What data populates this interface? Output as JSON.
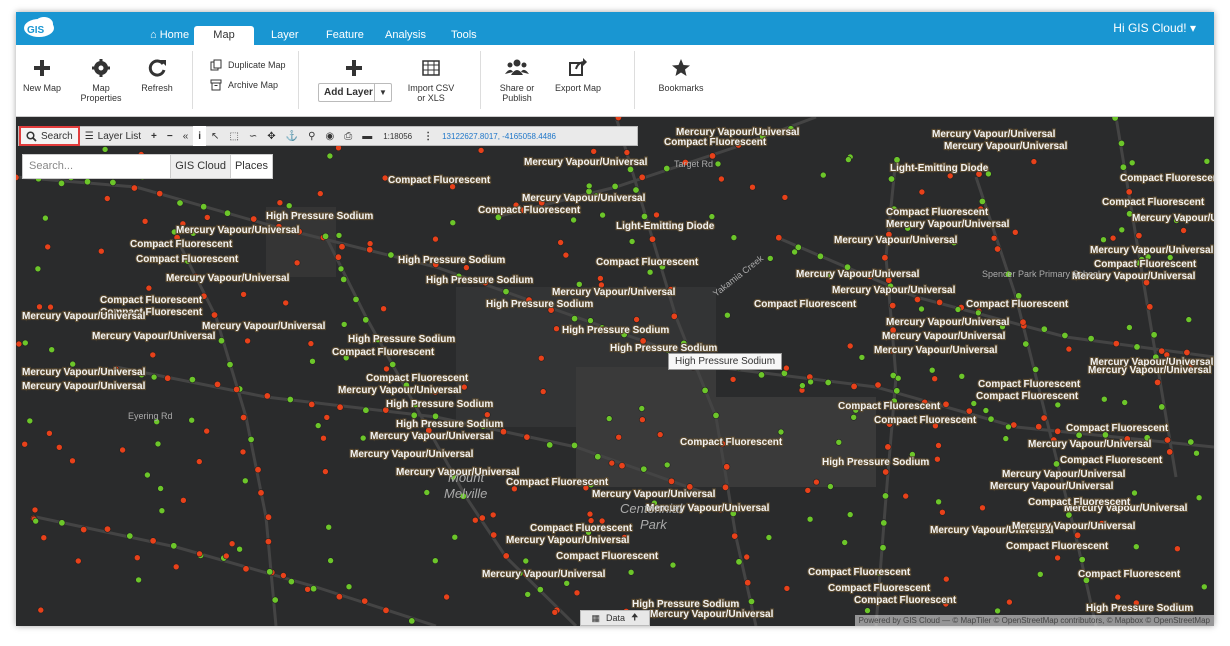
{
  "nav": {
    "logo": "GIS",
    "tabs": [
      {
        "label": "Home"
      },
      {
        "label": "Map"
      },
      {
        "label": "Layer"
      },
      {
        "label": "Feature"
      },
      {
        "label": "Analysis"
      },
      {
        "label": "Tools"
      }
    ],
    "user": "Hi GIS Cloud! ▾"
  },
  "ribbon": {
    "new_map": "New Map",
    "map_properties_1": "Map",
    "map_properties_2": "Properties",
    "refresh": "Refresh",
    "duplicate_map": "Duplicate Map",
    "archive_map": "Archive Map",
    "add_layer": "Add Layer",
    "import_1": "Import CSV",
    "import_2": "or XLS",
    "share_1": "Share or",
    "share_2": "Publish",
    "export_map": "Export Map",
    "bookmarks": "Bookmarks"
  },
  "maptool": {
    "search": "Search",
    "layer_list": "Layer List",
    "scale": "1:18056",
    "coords": "13122627.8017, -4165058.4486"
  },
  "search": {
    "placeholder": "Search...",
    "source_1": "GIS Cloud",
    "source_2": "Places"
  },
  "map": {
    "tooltip": "High Pressure Sodium",
    "attribution": "Powered by GIS Cloud — © MapTiler © OpenStreetMap contributors, © Mapbox © OpenStreetMap",
    "data_tab": "Data",
    "place_labels": [
      "Mount",
      "Melville",
      "Centennial",
      "Park",
      "Eyering Rd",
      "Yakamia Creek",
      "Target Rd",
      "Spencer Park Primary School"
    ],
    "feature_labels": [
      "Mercury Vapour/Universal",
      "Compact Fluorescent",
      "High Pressure Sodium",
      "Light-Emitting Diode"
    ]
  }
}
